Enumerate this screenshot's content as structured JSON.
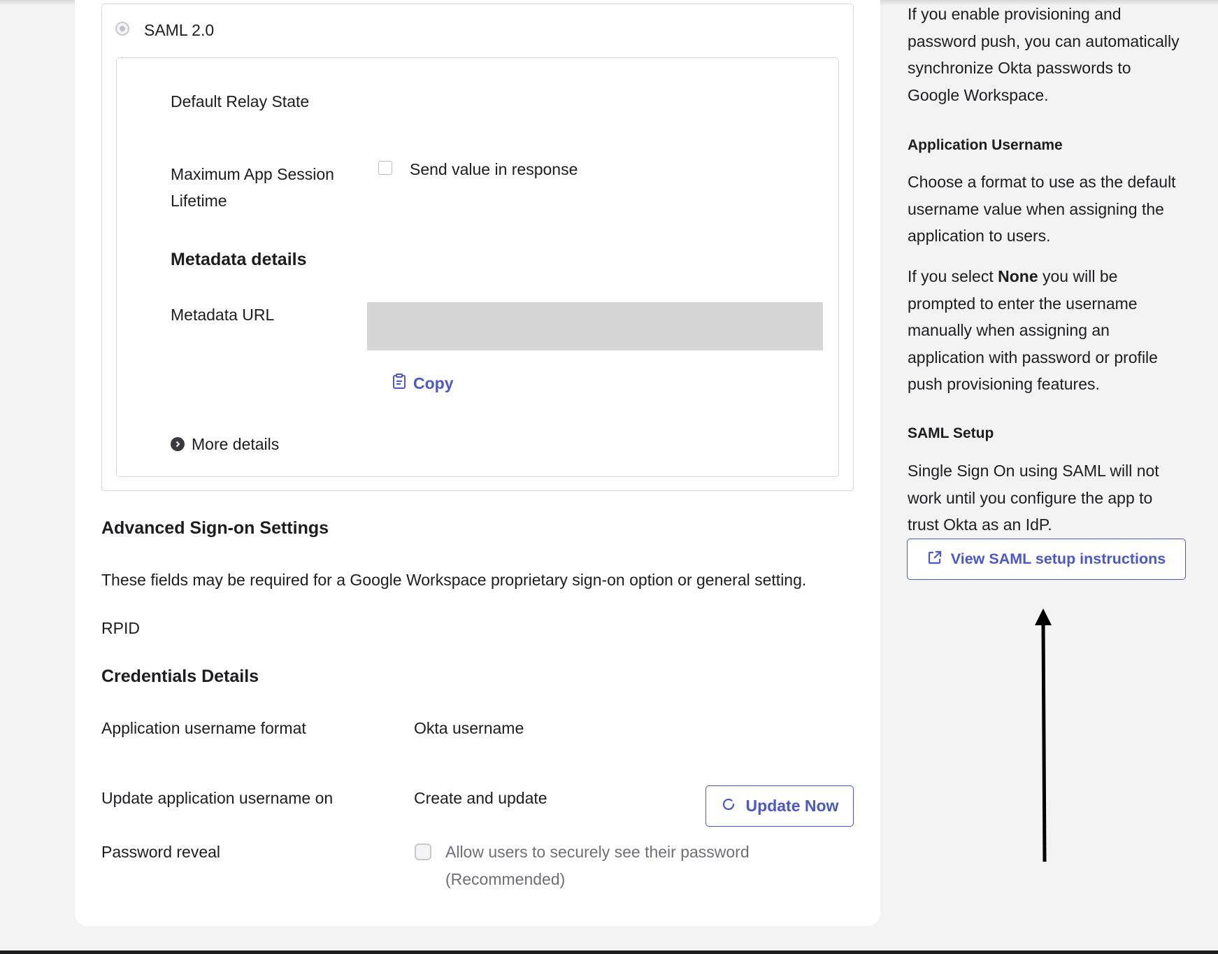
{
  "saml": {
    "radio_label": "SAML 2.0",
    "default_relay_state_label": "Default Relay State",
    "max_session_label_line1": "Maximum App Session",
    "max_session_label_line2": "Lifetime",
    "send_value_label": "Send value in response",
    "metadata_heading": "Metadata details",
    "metadata_url_label": "Metadata URL",
    "copy_label": "Copy",
    "more_details_label": "More details"
  },
  "advanced": {
    "heading": "Advanced Sign-on Settings",
    "description": "These fields may be required for a Google Workspace proprietary sign-on option or general setting.",
    "rpid_label": "RPID"
  },
  "credentials": {
    "heading": "Credentials Details",
    "username_format_label": "Application username format",
    "username_format_value": "Okta username",
    "update_on_label": "Update application username on",
    "update_on_value": "Create and update",
    "update_now_label": "Update Now",
    "password_reveal_label": "Password reveal",
    "password_reveal_option_line1": "Allow users to securely see their password",
    "password_reveal_option_line2": "(Recommended)"
  },
  "sidebar": {
    "provisioning_text": [
      "If you enable provisioning and",
      "password push, you can automatically",
      "synchronize Okta passwords to",
      "Google Workspace."
    ],
    "app_username_heading": "Application Username",
    "app_username_text": [
      "Choose a format to use as the default",
      "username value when assigning the",
      "application to users."
    ],
    "none_prefix": "If you select ",
    "none_bold": "None",
    "none_suffix": " you will be",
    "none_text": [
      "prompted to enter the username",
      "manually when assigning an",
      "application with password or profile",
      "push provisioning features."
    ],
    "saml_setup_heading": "SAML Setup",
    "saml_setup_text": [
      "Single Sign On using SAML will not",
      "work until you configure the app to",
      "trust Okta as an IdP."
    ],
    "saml_setup_button": "View SAML setup instructions"
  },
  "colors": {
    "accent": "#4b57cc",
    "background": "#f3f3f4",
    "card": "#ffffff",
    "metadata_field": "#d6d6d6"
  },
  "icons": [
    "clipboard-icon",
    "chevron-right-icon",
    "refresh-icon",
    "external-link-icon",
    "arrow-up-icon"
  ]
}
